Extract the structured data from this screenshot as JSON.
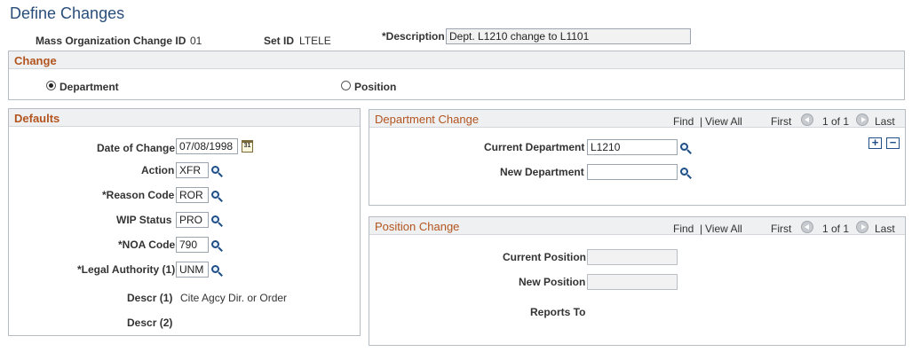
{
  "page": {
    "title": "Define Changes"
  },
  "header": {
    "mass_org_label": "Mass Organization Change ID",
    "mass_org_value": "01",
    "setid_label": "Set ID",
    "setid_value": "LTELE",
    "description_label": "*Description",
    "description_value": "Dept. L1210 change  to L1101"
  },
  "change": {
    "title": "Change",
    "options": [
      {
        "label": "Department",
        "selected": true
      },
      {
        "label": "Position",
        "selected": false
      }
    ]
  },
  "defaults": {
    "title": "Defaults",
    "date_label": "Date of Change",
    "date_value": "07/08/1998",
    "action_label": "Action",
    "action_value": "XFR",
    "reason_label": "*Reason Code",
    "reason_value": "ROR",
    "wip_label": "WIP Status",
    "wip_value": "PRO",
    "noa_label": "*NOA Code",
    "noa_value": "790",
    "legal_label": "*Legal Authority (1)",
    "legal_value": "UNM",
    "descr1_label": "Descr (1)",
    "descr1_value": "Cite Agcy Dir. or Order",
    "descr2_label": "Descr (2)",
    "calendar_glyph": "31"
  },
  "dept_change": {
    "title": "Department Change",
    "find": "Find",
    "separator": "|",
    "view_all": "View All",
    "first": "First",
    "count": "1 of 1",
    "last": "Last",
    "current_label": "Current Department",
    "current_value": "L1210",
    "new_label": "New Department",
    "new_value": "",
    "add_glyph": "+",
    "remove_glyph": "−"
  },
  "pos_change": {
    "title": "Position Change",
    "find": "Find",
    "separator": "|",
    "view_all": "View All",
    "first": "First",
    "count": "1 of 1",
    "last": "Last",
    "current_label": "Current Position",
    "new_label": "New Position",
    "reports_label": "Reports To"
  }
}
